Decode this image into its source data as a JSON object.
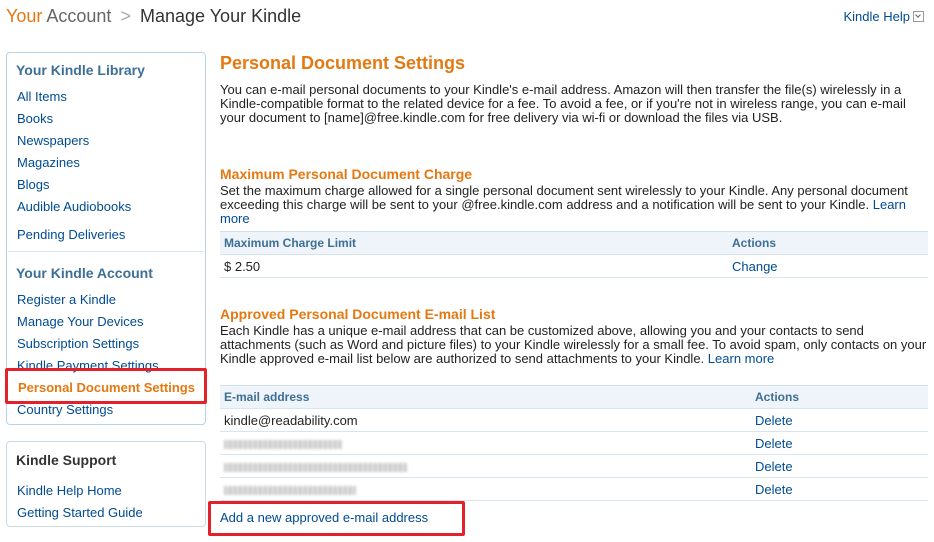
{
  "header": {
    "crumb_your": "Your",
    "crumb_account": "Account",
    "crumb_sep": ">",
    "crumb_current": "Manage Your Kindle",
    "help": "Kindle Help"
  },
  "sidebar": {
    "library_title": "Your Kindle Library",
    "library_items": [
      "All Items",
      "Books",
      "Newspapers",
      "Magazines",
      "Blogs",
      "Audible Audiobooks"
    ],
    "pending": "Pending Deliveries",
    "account_title": "Your Kindle Account",
    "account_items": [
      "Register a Kindle",
      "Manage Your Devices",
      "Subscription Settings",
      "Kindle Payment Settings",
      "Personal Document Settings",
      "Country Settings"
    ],
    "support_title": "Kindle Support",
    "support_items": [
      "Kindle Help Home",
      "Getting Started Guide"
    ]
  },
  "main": {
    "title": "Personal Document Settings",
    "intro": "You can e-mail personal documents to your Kindle's e-mail address. Amazon will then transfer the file(s) wirelessly in a Kindle-compatible format to the related device for a fee. To avoid a fee, or if you're not in wireless range, you can e-mail your document to [name]@free.kindle.com for free delivery via wi-fi or download the files via USB.",
    "charge_title": "Maximum Personal Document Charge",
    "charge_text": "Set the maximum charge allowed for a single personal document sent wirelessly to your Kindle. Any personal document exceeding this charge will be sent to your @free.kindle.com address and a notification will be sent to your Kindle.",
    "learn_more": "Learn more",
    "charge_table": {
      "col_limit": "Maximum Charge Limit",
      "col_actions": "Actions",
      "limit_value": "$ 2.50",
      "action": "Change"
    },
    "email_title": "Approved Personal Document E-mail List",
    "email_text": "Each Kindle has a unique e-mail address that can be customized above, allowing you and your contacts to send attachments (such as Word and picture files) to your Kindle wirelessly for a small fee. To avoid spam, only contacts on your Kindle approved e-mail list below are authorized to send attachments to your Kindle.",
    "learn_more_2": "Learn more",
    "email_table": {
      "col_email": "E-mail address",
      "col_actions": "Actions",
      "first_email": "kindle@readability.com",
      "delete": "Delete"
    },
    "add_link": "Add a new approved e-mail address"
  }
}
